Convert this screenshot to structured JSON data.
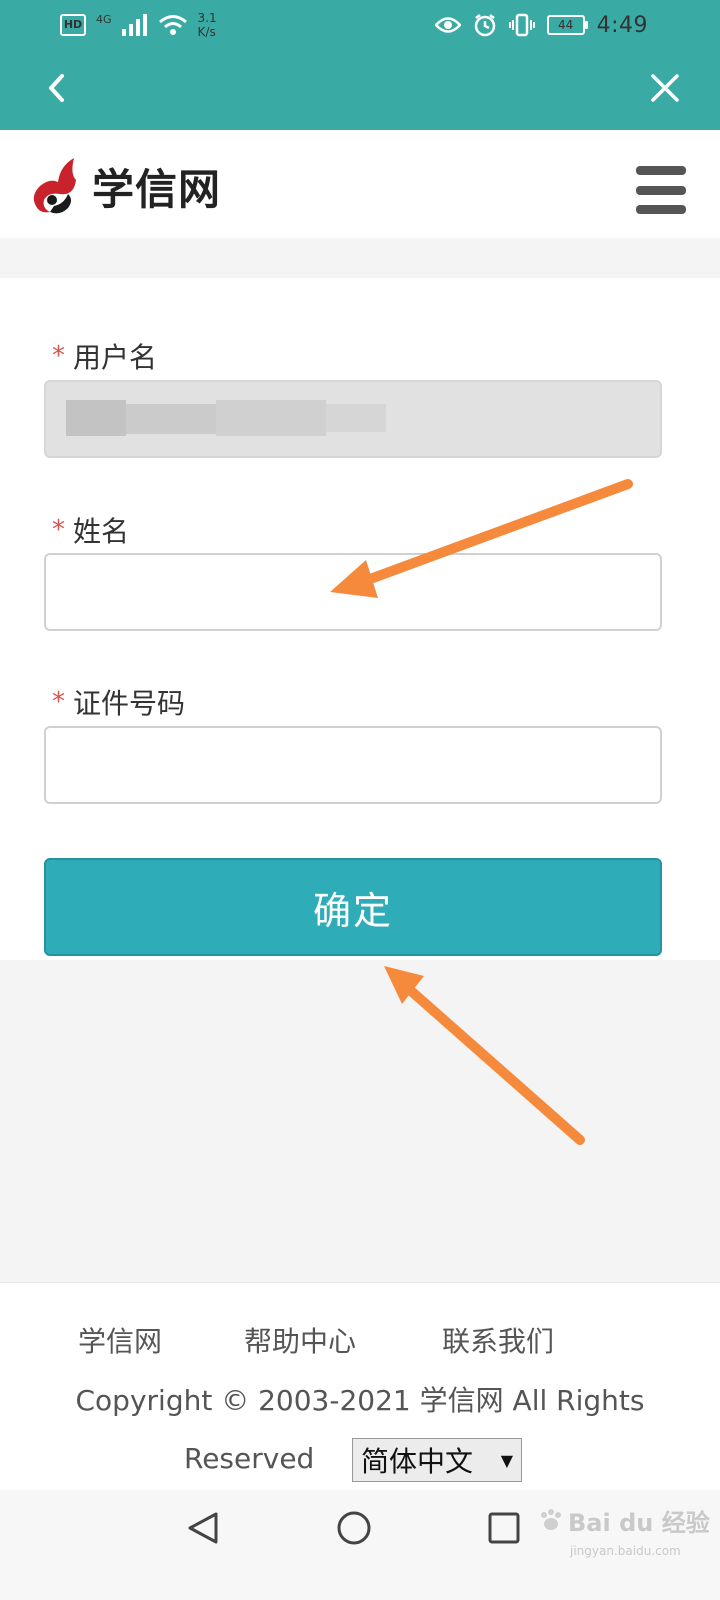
{
  "status_bar": {
    "hd": "HD",
    "network": "4G",
    "speed_value": "3.1",
    "speed_unit": "K/s",
    "battery": "44",
    "time": "4:49"
  },
  "nav": {
    "back_symbol": "‹",
    "close_symbol": "✕"
  },
  "header": {
    "logo_text": "学信网",
    "menu_icon": "hamburger-menu-icon"
  },
  "form": {
    "username_label": "用户名",
    "username_value": "",
    "name_label": "姓名",
    "name_value": "",
    "id_label": "证件号码",
    "id_value": "",
    "required_mark": "*",
    "confirm_label": "确定"
  },
  "footer": {
    "links": [
      "学信网",
      "帮助中心",
      "联系我们"
    ],
    "copyright": "Copyright © 2003-2021  学信网  All Rights",
    "reserved": "Reserved",
    "language": "简体中文",
    "language_caret": "▼"
  },
  "watermark": {
    "brand": "Bai du 经验",
    "url": "jingyan.baidu.com"
  },
  "colors": {
    "teal_bar": "#3aaaa4",
    "button": "#2eadb9",
    "required_star": "#d9534f",
    "annotation_arrow": "#f58a3c"
  }
}
